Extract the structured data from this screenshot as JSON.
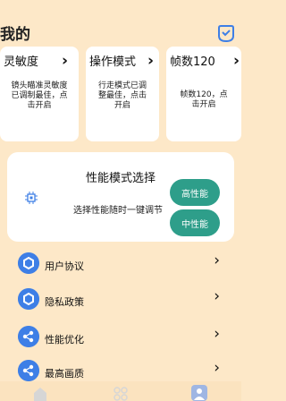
{
  "header": {
    "title": "我的",
    "icon": "check-badge-icon"
  },
  "cards": [
    {
      "title": "灵敏度",
      "desc": "镜头瞄准灵敏度已调制最佳，点击开启"
    },
    {
      "title": "操作模式",
      "desc": "行走模式已调整最佳，点击开启"
    },
    {
      "title": "帧数120",
      "desc": "帧数120，点击开启"
    }
  ],
  "perf": {
    "title": "性能模式选择",
    "subtitle": "选择性能随时一键调节",
    "options": [
      "高性能",
      "中性能"
    ],
    "icon": "chip-icon",
    "accent": "#2e9e8a"
  },
  "menu": [
    {
      "label": "用户协议",
      "icon": "hexagon-icon"
    },
    {
      "label": "隐私政策",
      "icon": "hexagon-icon"
    },
    {
      "label": "性能优化",
      "icon": "share-nodes-icon"
    },
    {
      "label": "最高画质",
      "icon": "share-nodes-icon"
    }
  ],
  "tabbar": {
    "tabs": [
      "home-icon",
      "grid-icon",
      "user-icon"
    ],
    "active_index": 2
  },
  "colors": {
    "background": "#fde8c8",
    "menu_icon": "#3e7fe6"
  }
}
